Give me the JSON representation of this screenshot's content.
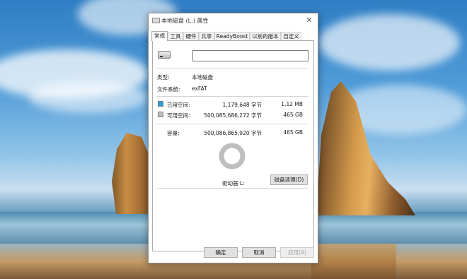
{
  "window": {
    "title": "本地磁盘 (L:) 属性",
    "close_glyph": "✕"
  },
  "tabs": [
    {
      "label": "常规",
      "active": true
    },
    {
      "label": "工具",
      "active": false
    },
    {
      "label": "硬件",
      "active": false
    },
    {
      "label": "共享",
      "active": false
    },
    {
      "label": "ReadyBoost",
      "active": false
    },
    {
      "label": "以前的版本",
      "active": false
    },
    {
      "label": "自定义",
      "active": false
    }
  ],
  "general": {
    "volume_name_value": "",
    "type_label": "类型:",
    "type_value": "本地磁盘",
    "fs_label": "文件系统:",
    "fs_value": "exFAT",
    "used": {
      "label": "已用空间:",
      "bytes": "1,179,648 字节",
      "size": "1.12 MB",
      "color": "#26a0da"
    },
    "free": {
      "label": "可用空间:",
      "bytes": "500,085,686,272 字节",
      "size": "465 GB",
      "color": "#bebebe"
    },
    "capacity": {
      "label": "容量:",
      "bytes": "500,086,865,920 字节",
      "size": "465 GB"
    },
    "used_fraction": 2.4e-06,
    "drive_label": "驱动器 L:",
    "cleanup_button": "磁盘清理(D)"
  },
  "footer": {
    "ok": "确定",
    "cancel": "取消",
    "apply": "应用(A)"
  },
  "icons": {
    "drive": "drive-icon",
    "title": "drive-icon"
  }
}
